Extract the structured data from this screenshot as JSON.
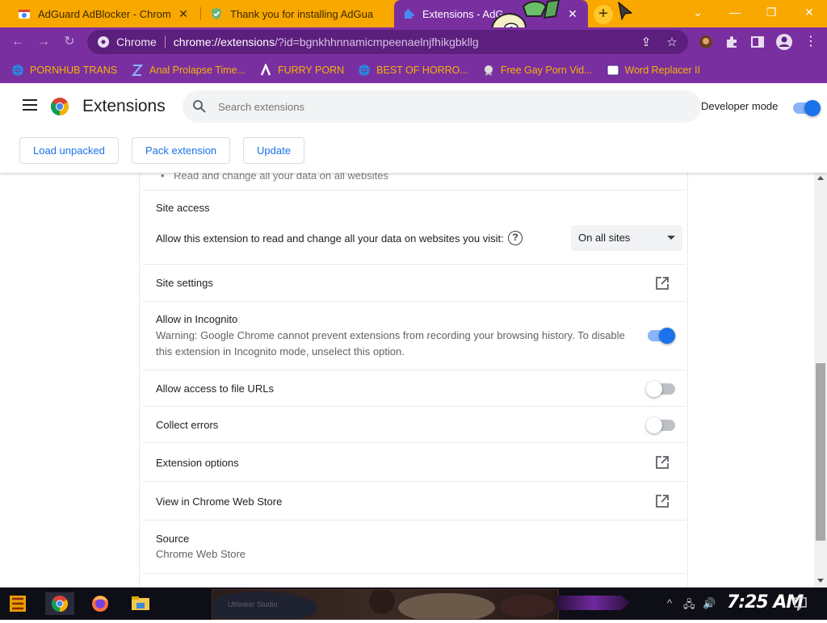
{
  "browser": {
    "tabs": [
      {
        "title": "AdGuard AdBlocker - Chrome W",
        "active": false
      },
      {
        "title": "Thank you for installing AdGua",
        "active": false
      },
      {
        "title": "Extensions - AdG",
        "active": true
      }
    ],
    "close_glyph": "✕",
    "new_tab_glyph": "+",
    "window_controls": {
      "dropdown": "⌄",
      "minimize": "—",
      "restore": "❐",
      "close": "✕"
    },
    "omnibox": {
      "site_label": "Chrome",
      "url_host": "chrome://extensions",
      "url_rest": "/?id=bgnkhhnnamicmpeenaelnjfhikgbkllg"
    },
    "bookmarks": [
      {
        "label": "PORNHUB TRANS",
        "icon": "globe-icon"
      },
      {
        "label": "Anal Prolapse Time...",
        "icon": "bracket-icon"
      },
      {
        "label": "FURRY PORN",
        "icon": "lambda-icon"
      },
      {
        "label": "BEST OF HORRO...",
        "icon": "globe-icon"
      },
      {
        "label": "Free Gay Porn Vid...",
        "icon": "badge-icon"
      },
      {
        "label": "Word Replacer II",
        "icon": "wr-icon"
      }
    ]
  },
  "extensions_page": {
    "title": "Extensions",
    "search_placeholder": "Search extensions",
    "developer_mode_label": "Developer mode",
    "developer_mode_on": true,
    "buttons": {
      "load_unpacked": "Load unpacked",
      "pack_extension": "Pack extension",
      "update": "Update"
    }
  },
  "details": {
    "truncated_permission": "Read and change all your data on all websites",
    "site_access": {
      "heading": "Site access",
      "description": "Allow this extension to read and change all your data on websites you visit:",
      "help_glyph": "?",
      "selected": "On all sites"
    },
    "site_settings": "Site settings",
    "incognito": {
      "label": "Allow in Incognito",
      "warning_line1": "Warning: Google Chrome cannot prevent extensions from recording your browsing history. To disable",
      "warning_line2": "this extension in Incognito mode, unselect this option.",
      "enabled": true
    },
    "file_urls": {
      "label": "Allow access to file URLs",
      "enabled": false
    },
    "collect_errors": {
      "label": "Collect errors",
      "enabled": false
    },
    "extension_options": "Extension options",
    "web_store": "View in Chrome Web Store",
    "source": {
      "label": "Source",
      "value": "Chrome Web Store"
    }
  },
  "taskbar": {
    "clock": "7:25 AM",
    "preview_text": "Uthinker Studio"
  },
  "colors": {
    "tabstrip": "#f9a800",
    "toolbar": "#7a2fa0",
    "accent_blue": "#1a73e8",
    "bookmark_text": "#f4b400"
  }
}
